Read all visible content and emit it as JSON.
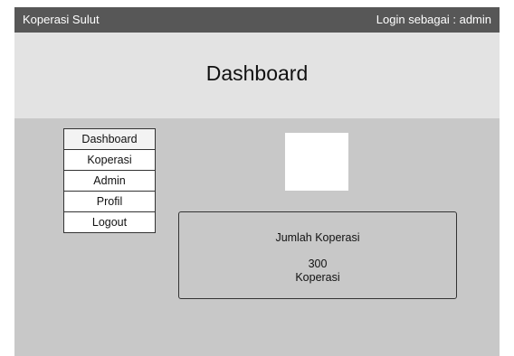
{
  "topbar": {
    "brand": "Koperasi Sulut",
    "login_status": "Login sebagai : admin"
  },
  "header": {
    "title": "Dashboard"
  },
  "nav": {
    "items": [
      {
        "label": "Dashboard"
      },
      {
        "label": "Koperasi"
      },
      {
        "label": "Admin"
      },
      {
        "label": "Profil"
      },
      {
        "label": "Logout"
      }
    ]
  },
  "stat_card": {
    "label": "Jumlah Koperasi",
    "value": "300",
    "unit": "Koperasi"
  },
  "colors": {
    "topbar": "#575757",
    "header": "#e3e3e3",
    "content": "#c8c8c8"
  }
}
